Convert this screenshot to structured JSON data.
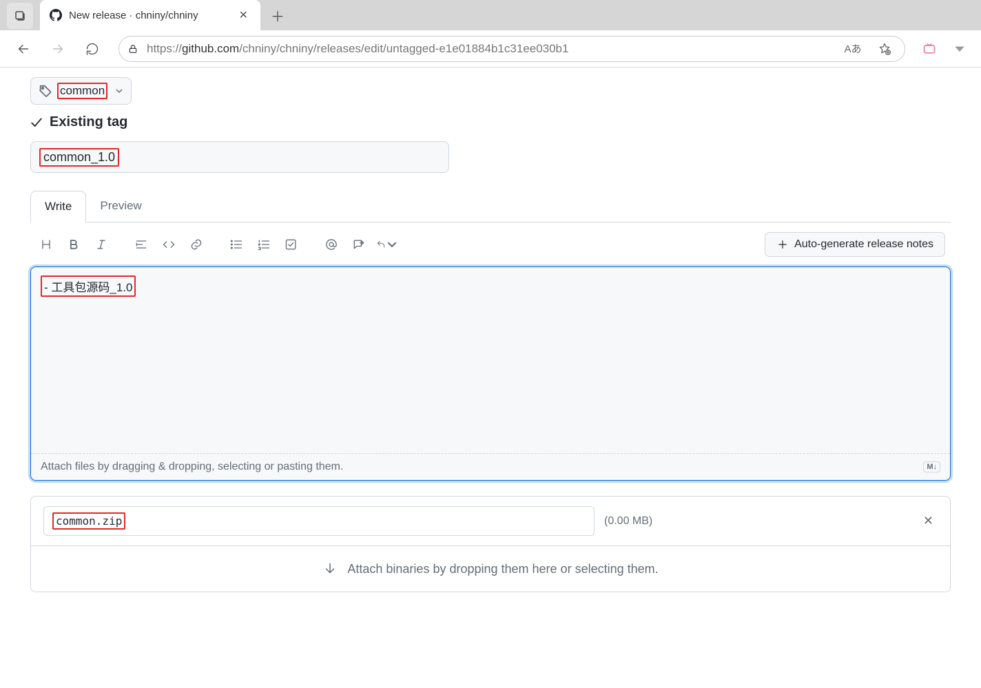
{
  "browser": {
    "tab_title": "New release · chniny/chniny",
    "url_prefix": "https://",
    "url_host": "github.com",
    "url_path": "/chniny/chniny/releases/edit/untagged-e1e01884b1c31ee030b1"
  },
  "release": {
    "tag_name": "common",
    "existing_tag_label": "Existing tag",
    "title_value": "common_1.0",
    "tabs": {
      "write": "Write",
      "preview": "Preview"
    },
    "auto_generate_label": "Auto-generate release notes",
    "body_value": "- 工具包源码_1.0",
    "attach_hint": "Attach files by dragging & dropping, selecting or pasting them.",
    "markdown_badge": "M↓"
  },
  "asset": {
    "name": "common.zip",
    "size": "(0.00 MB)",
    "drop_hint": "Attach binaries by dropping them here or selecting them."
  }
}
